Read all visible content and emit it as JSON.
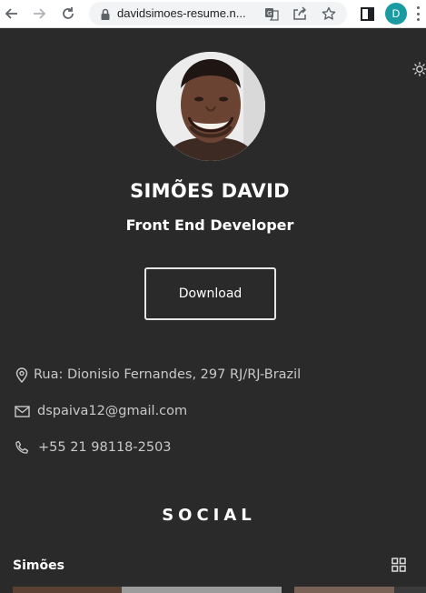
{
  "browser": {
    "url": "davidsimoes-resume.n...",
    "profile_initial": "D"
  },
  "profile": {
    "name": "SIMÕES DAVID",
    "role": "Front End Developer",
    "download_label": "Download"
  },
  "contact": {
    "address": "Rua: Dionisio Fernandes, 297 RJ/RJ-Brazil",
    "email": "dspaiva12@gmail.com",
    "phone": "+55 21 98118-2503"
  },
  "social": {
    "heading": "SOCIAL",
    "card_title": "Simões"
  },
  "colors": {
    "background": "#2a2a2a",
    "text": "#ffffff",
    "muted_text": "#c9c9c9",
    "profile_badge": "#1a9ba1"
  },
  "icons": {
    "back": "arrow-left-icon",
    "forward": "arrow-right-icon",
    "reload": "reload-icon",
    "lock": "lock-icon",
    "translate": "translate-icon",
    "share": "share-icon",
    "bookmark": "star-icon",
    "side_panel": "side-panel-icon",
    "menu": "kebab-menu-icon",
    "theme": "sun-icon",
    "address": "map-pin-icon",
    "email": "mail-icon",
    "phone": "phone-icon",
    "grid": "grid-icon"
  }
}
